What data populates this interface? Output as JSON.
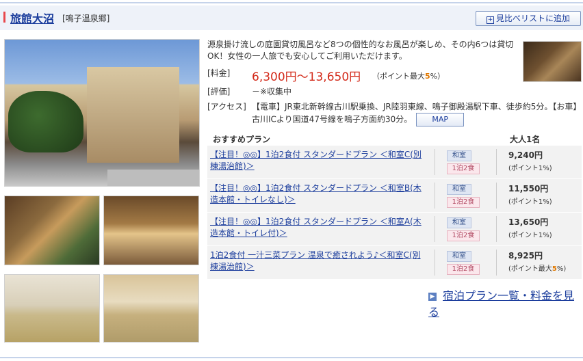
{
  "hotel": {
    "name": "旅館大沼",
    "area": "[鳴子温泉郷]",
    "compare_button": "見比べリストに追加",
    "description": "源泉掛け流しの庭園貸切風呂など8つの個性的なお風呂が楽しめ、その内6つは貸切OK！女性の一人旅でも安心してご利用いただけます。",
    "price_label": "[料金]",
    "price": "6,300円〜13,650円",
    "point_text": "（ポイント最大",
    "point_value": "5",
    "point_suffix": "%）",
    "rating_label": "[評価]",
    "rating": "－※収集中",
    "access_label": "[アクセス]",
    "access": "【電車】JR東北新幹線古川駅乗換、JR陸羽東線、鳴子御殿湯駅下車、徒歩約5分。【お車】古川ICより国道47号線を鳴子方面約30分。",
    "map_button": "MAP"
  },
  "plans_header": {
    "col_plan": "おすすめプラン",
    "col_price": "大人1名"
  },
  "plans": [
    {
      "name": "【注目！◎◎】1泊2食付 スタンダードプラン ＜和室C(別棟湯治館)＞",
      "room": "和室",
      "meal": "1泊2食",
      "price": "9,240円",
      "point_label": "(ポイント",
      "point_value": "1",
      "point_suffix": "%)"
    },
    {
      "name": "【注目！◎◎】1泊2食付 スタンダードプラン ＜和室B(木造本館・トイレなし)＞",
      "room": "和室",
      "meal": "1泊2食",
      "price": "11,550円",
      "point_label": "(ポイント",
      "point_value": "1",
      "point_suffix": "%)"
    },
    {
      "name": "【注目！◎◎】1泊2食付 スタンダードプラン ＜和室A(木造本館・トイレ付)＞",
      "room": "和室",
      "meal": "1泊2食",
      "price": "13,650円",
      "point_label": "(ポイント",
      "point_value": "1",
      "point_suffix": "%)"
    },
    {
      "name": "1泊2食付 一汁三菜プラン 温泉で癒されよう♪＜和室C(別棟湯治館)＞",
      "room": "和室",
      "meal": "1泊2食",
      "price": "8,925円",
      "point_label": "(ポイント最大",
      "point_value": "5",
      "point_suffix": "%)"
    }
  ],
  "more_link": "宿泊プラン一覧・料金を見る",
  "colors": {
    "accent": "#1a3c9c",
    "price": "#d32a1a",
    "highlight": "#e07800"
  }
}
